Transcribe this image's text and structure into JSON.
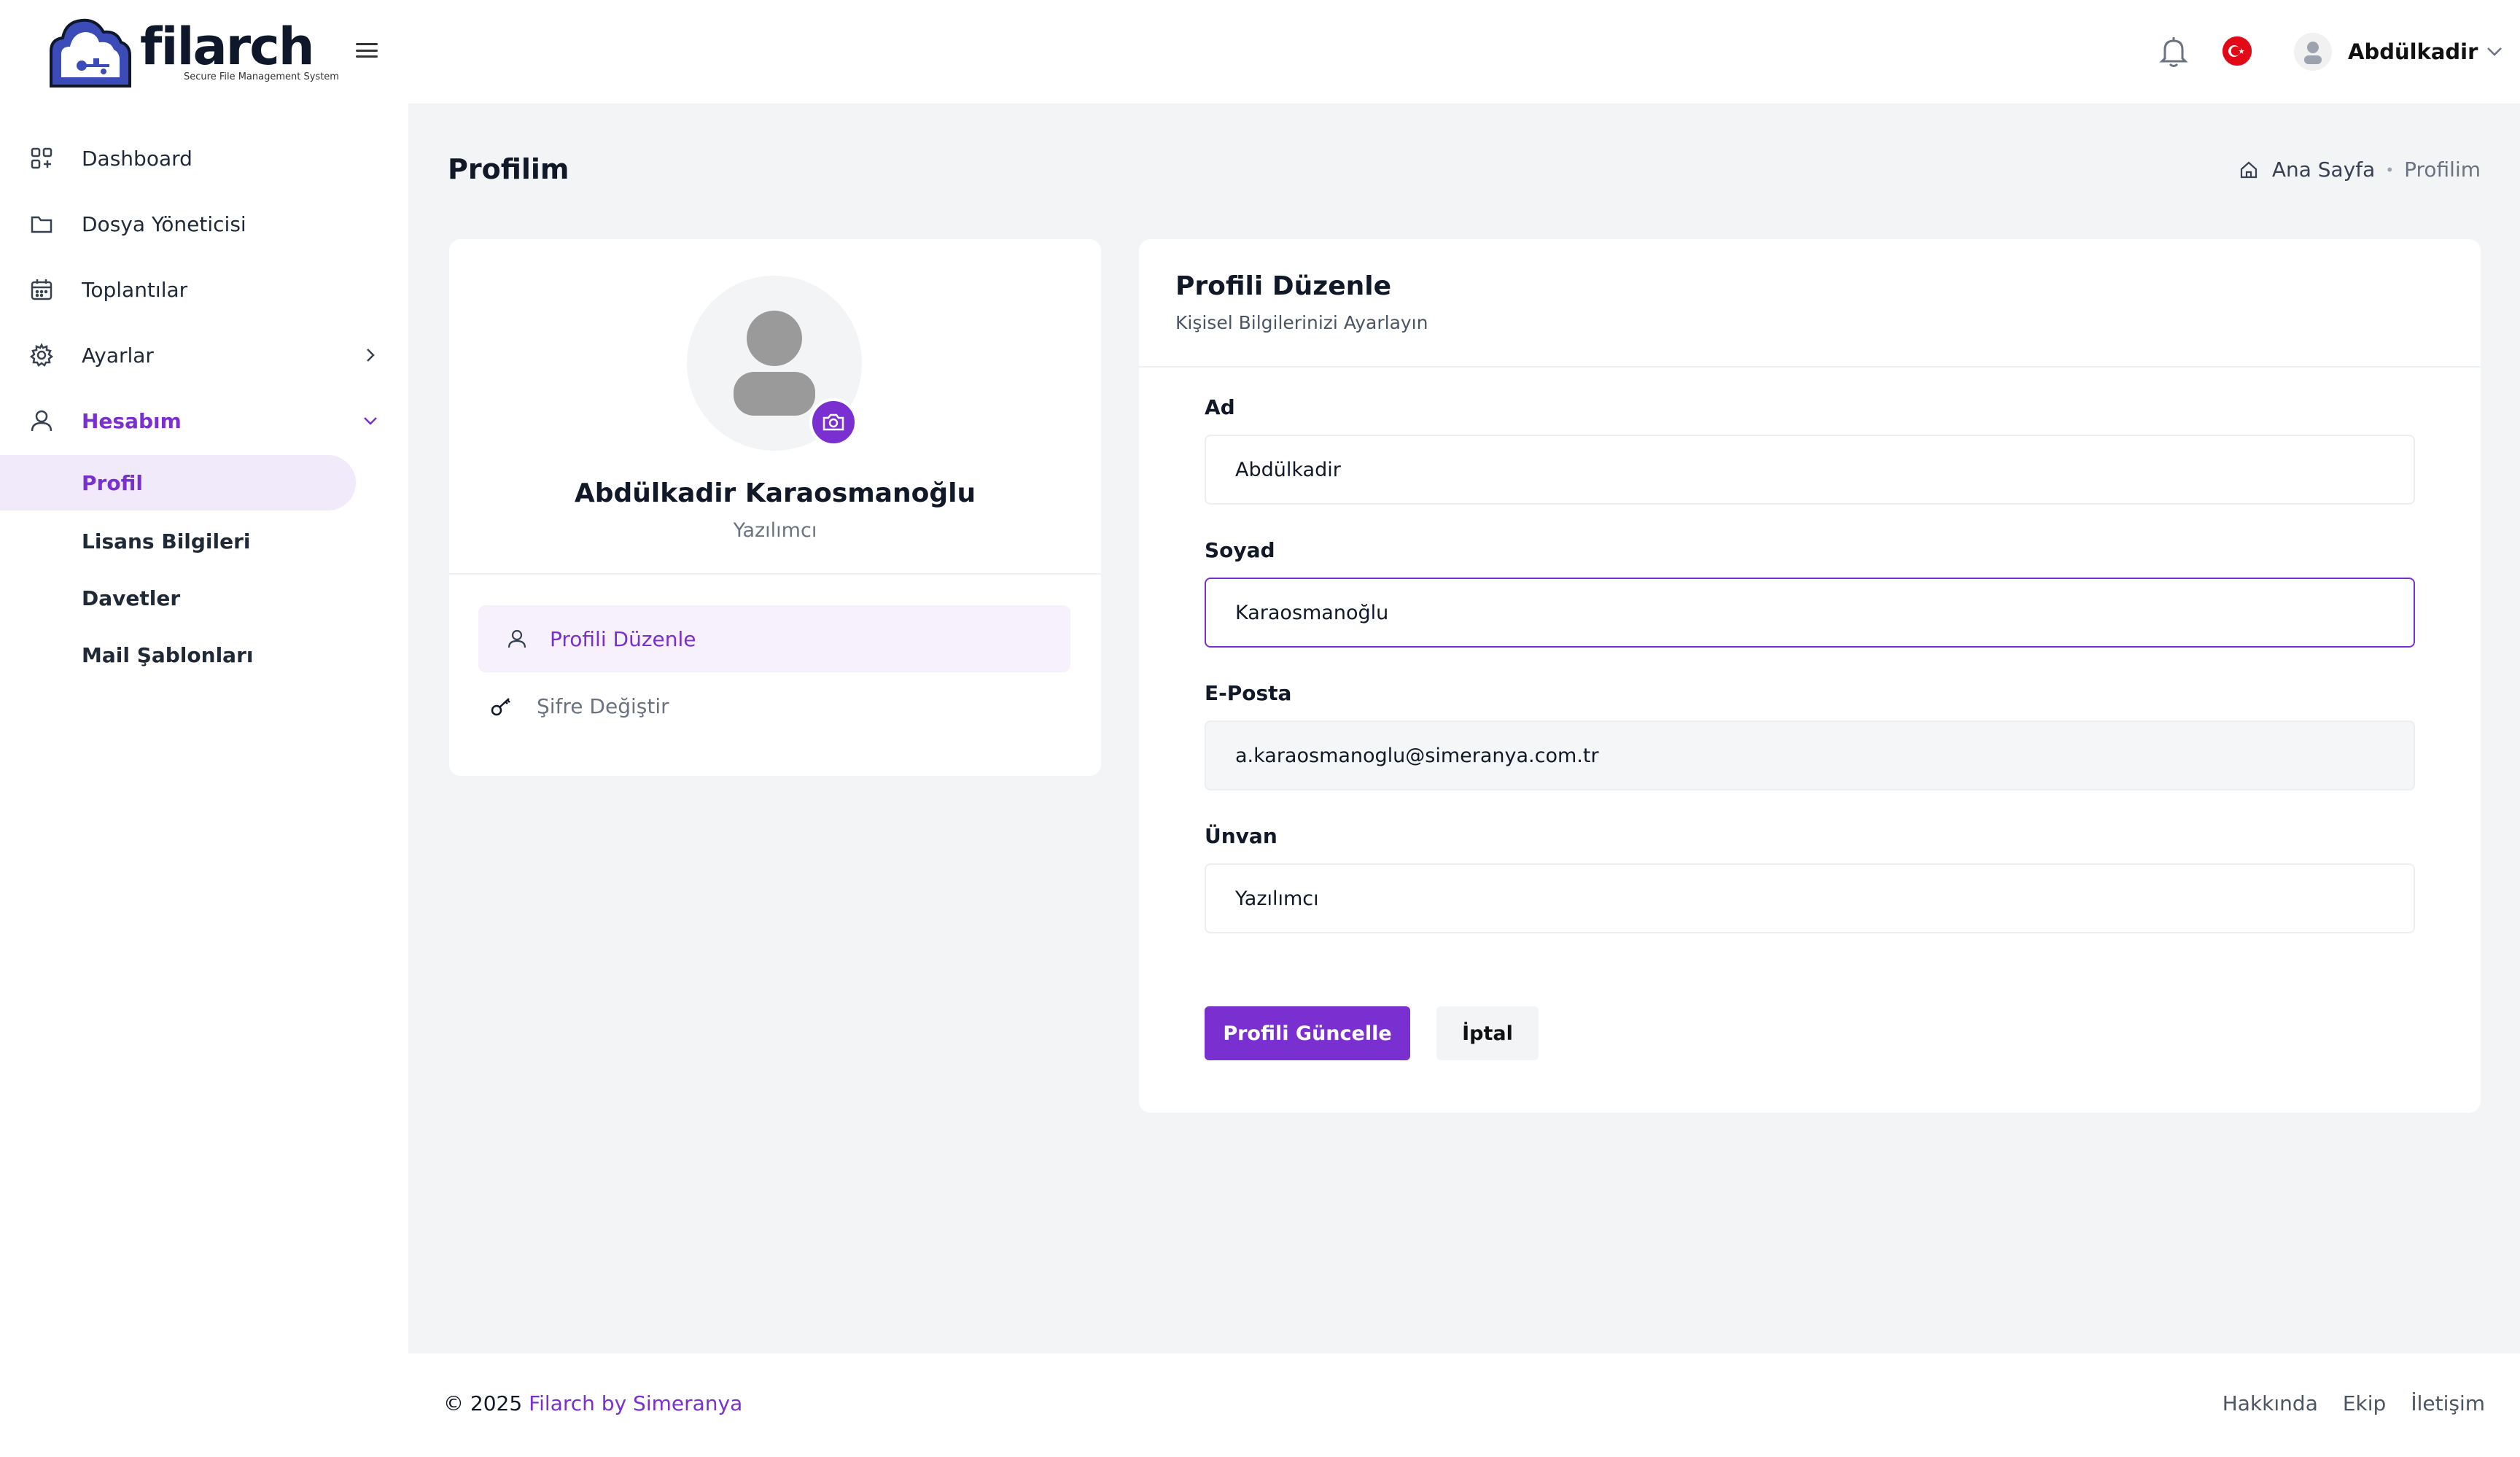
{
  "brand": {
    "name": "filarch",
    "tagline": "Secure File Management System"
  },
  "header": {
    "user_name": "Abdülkadir",
    "flag_icon": "turkey-flag-icon",
    "accent_color": "#7a2fd0"
  },
  "sidebar": {
    "items": [
      {
        "label": "Dashboard",
        "icon": "dashboard-icon"
      },
      {
        "label": "Dosya Yöneticisi",
        "icon": "folder-icon"
      },
      {
        "label": "Toplantılar",
        "icon": "calendar-icon"
      },
      {
        "label": "Ayarlar",
        "icon": "gear-icon"
      },
      {
        "label": "Hesabım",
        "icon": "user-icon"
      }
    ],
    "sub_items": [
      {
        "label": "Profil"
      },
      {
        "label": "Lisans Bilgileri"
      },
      {
        "label": "Davetler"
      },
      {
        "label": "Mail Şablonları"
      }
    ]
  },
  "page": {
    "title": "Profilim",
    "breadcrumb": {
      "home": "Ana Sayfa",
      "current": "Profilim"
    }
  },
  "profile_card": {
    "name": "Abdülkadir Karaosmanoğlu",
    "title": "Yazılımcı",
    "menu": [
      {
        "label": "Profili Düzenle"
      },
      {
        "label": "Şifre Değiştir"
      }
    ]
  },
  "edit_form": {
    "title": "Profili Düzenle",
    "subtitle": "Kişisel Bilgilerinizi Ayarlayın",
    "fields": [
      {
        "label": "Ad",
        "value": "Abdülkadir"
      },
      {
        "label": "Soyad",
        "value": "Karaosmanoğlu"
      },
      {
        "label": "E-Posta",
        "value": "a.karaosmanoglu@simeranya.com.tr"
      },
      {
        "label": "Ünvan",
        "value": "Yazılımcı"
      }
    ],
    "submit_label": "Profili Güncelle",
    "cancel_label": "İptal"
  },
  "footer": {
    "copyright_prefix": "© 2025",
    "copyright_link": "Filarch by Simeranya",
    "links": [
      "Hakkında",
      "Ekip",
      "İletişim"
    ]
  }
}
